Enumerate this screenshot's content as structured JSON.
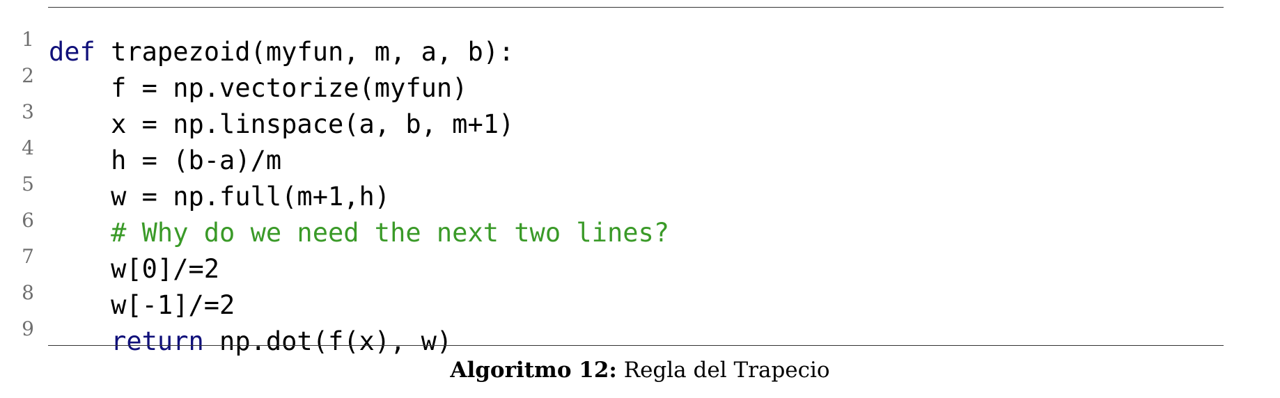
{
  "listing": {
    "lines": [
      {
        "number": "1",
        "indent": "",
        "keyword": "def",
        "text": " trapezoid(myfun, m, a, b):",
        "comment": ""
      },
      {
        "number": "2",
        "indent": "    ",
        "keyword": "",
        "text": "f = np.vectorize(myfun)",
        "comment": ""
      },
      {
        "number": "3",
        "indent": "    ",
        "keyword": "",
        "text": "x = np.linspace(a, b, m+1)",
        "comment": ""
      },
      {
        "number": "4",
        "indent": "    ",
        "keyword": "",
        "text": "h = (b-a)/m",
        "comment": ""
      },
      {
        "number": "5",
        "indent": "    ",
        "keyword": "",
        "text": "w = np.full(m+1,h)",
        "comment": ""
      },
      {
        "number": "6",
        "indent": "    ",
        "keyword": "",
        "text": "",
        "comment": "# Why do we need the next two lines?"
      },
      {
        "number": "7",
        "indent": "    ",
        "keyword": "",
        "text": "w[0]/=2",
        "comment": ""
      },
      {
        "number": "8",
        "indent": "    ",
        "keyword": "",
        "text": "w[-1]/=2",
        "comment": ""
      },
      {
        "number": "9",
        "indent": "    ",
        "keyword": "return",
        "text": " np.dot(f(x), w)",
        "comment": ""
      }
    ],
    "colors": {
      "keyword": "#10107a",
      "comment": "#3a9a28",
      "line_number": "#6f6f6f"
    }
  },
  "caption": {
    "label": "Algoritmo 12:",
    "text": " Regla del Trapecio"
  }
}
